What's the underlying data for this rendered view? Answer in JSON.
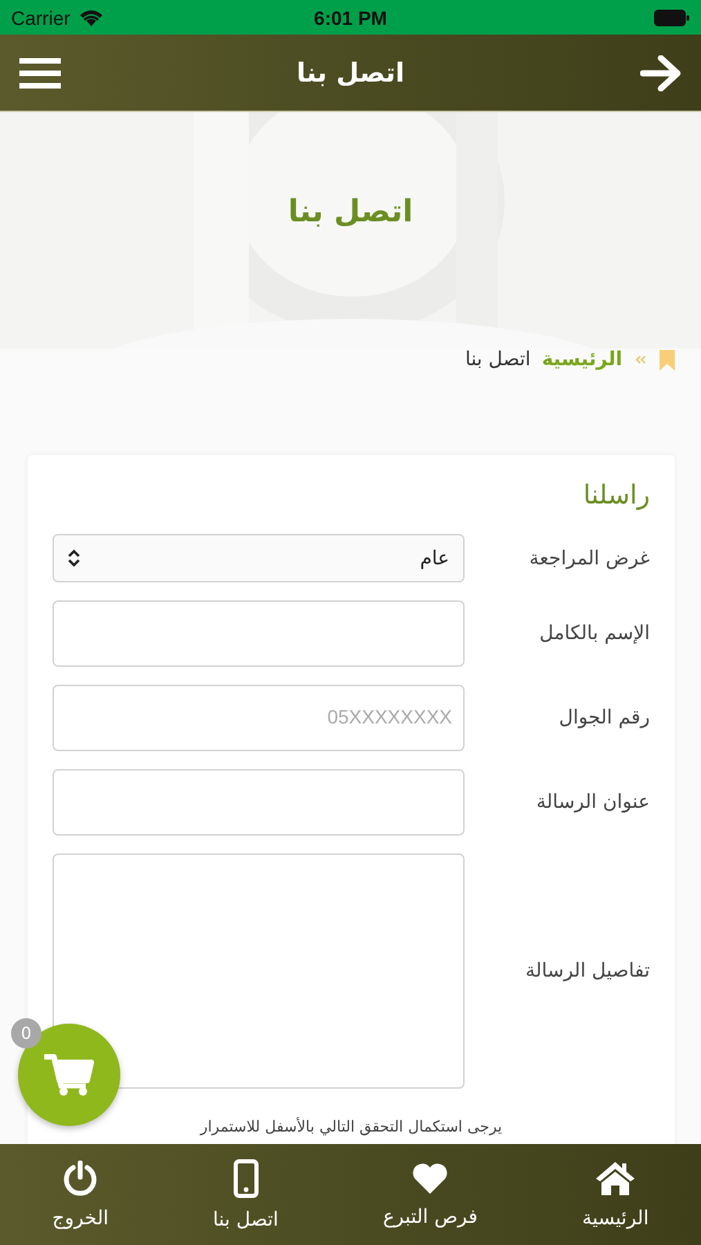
{
  "status_bar": {
    "carrier": "Carrier",
    "time": "6:01 PM"
  },
  "nav_bar": {
    "title": "اتصل بنا"
  },
  "hero": {
    "kind": "picture",
    "title": "اتصل بنا"
  },
  "breadcrumb": [
    {
      "label": "الرئيسية",
      "selected": false
    },
    {
      "label": "اتصل بنا",
      "selected": true
    }
  ],
  "form": {
    "title": "راسلنا",
    "fields": [
      {
        "kind": "select",
        "label": "غرض المراجعة",
        "value": "عام"
      },
      {
        "kind": "text",
        "label": "الإسم بالكامل"
      },
      {
        "kind": "text",
        "label": "رقم الجوال",
        "placeholder": "05XXXXXXXX"
      },
      {
        "kind": "text",
        "label": "عنوان الرسالة"
      },
      {
        "kind": "textarea",
        "label": "تفاصيل الرسالة"
      }
    ],
    "note": "يرجى استكمال التحقق التالي بالأسفل للاستمرار"
  },
  "cart": {
    "count": "0"
  },
  "tab_bar": [
    {
      "kind": "home",
      "label": "الرئيسية"
    },
    {
      "kind": "heart",
      "label": "فرص التبرع"
    },
    {
      "kind": "phone",
      "label": "اتصل بنا"
    },
    {
      "kind": "power",
      "label": "الخروج"
    }
  ]
}
